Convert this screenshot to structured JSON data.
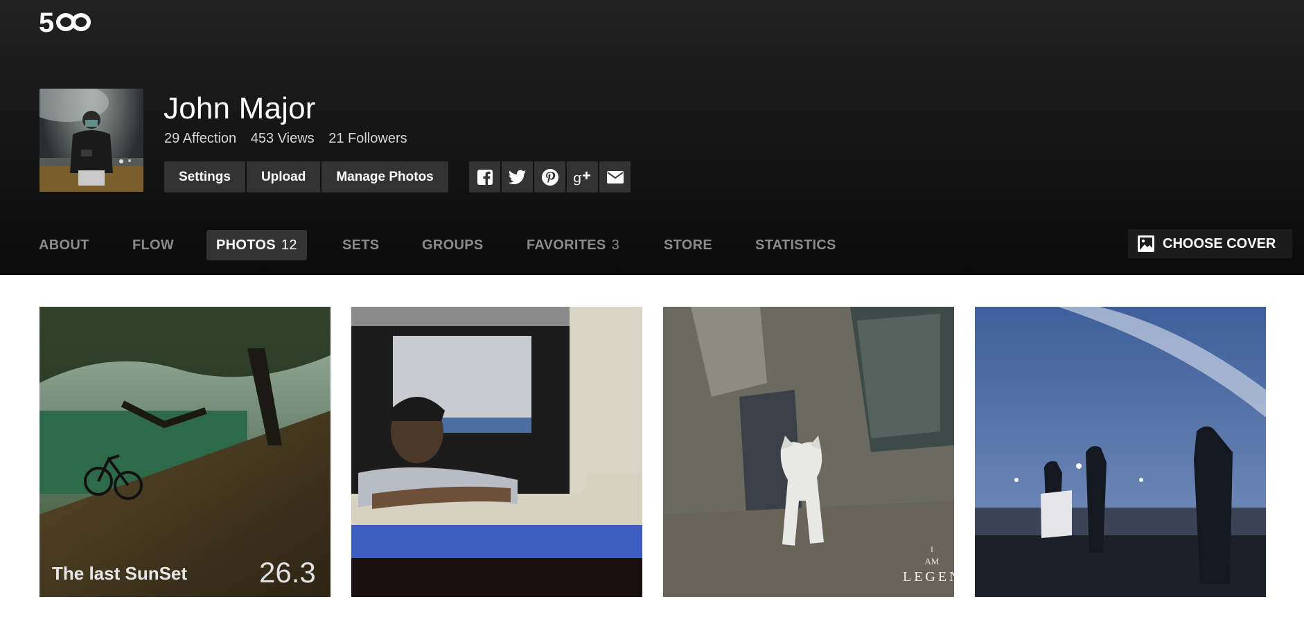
{
  "logo": {
    "text": "500px",
    "icon": "500px-logo"
  },
  "profile": {
    "name": "John Major",
    "avatar_icon": "user-avatar",
    "stats": {
      "affection": "29 Affection",
      "views": "453 Views",
      "followers": "21 Followers"
    }
  },
  "actions": {
    "settings": "Settings",
    "upload": "Upload",
    "manage": "Manage Photos"
  },
  "share_icons": [
    "facebook-icon",
    "twitter-icon",
    "pinterest-icon",
    "google-plus-icon",
    "email-icon"
  ],
  "nav": {
    "about": "ABOUT",
    "flow": "FLOW",
    "photos": "PHOTOS",
    "photos_count": "12",
    "sets": "SETS",
    "groups": "GROUPS",
    "favorites": "FAVORITES",
    "favorites_count": "3",
    "store": "STORE",
    "statistics": "STATISTICS",
    "active": "PHOTOS"
  },
  "cover": {
    "label": "CHOOSE COVER",
    "icon": "image-icon"
  },
  "photos": [
    {
      "overlay_title": "The last SunSet",
      "overlay_value": "26.3"
    },
    {},
    {
      "watermark_top": "I",
      "watermark_mid": "AM",
      "watermark_bottom": "LEGEN"
    },
    {}
  ],
  "colors": {
    "header_bg": "#141414",
    "button_bg": "#333333",
    "nav_inactive": "#8b8b8b",
    "text_white": "#ffffff"
  }
}
